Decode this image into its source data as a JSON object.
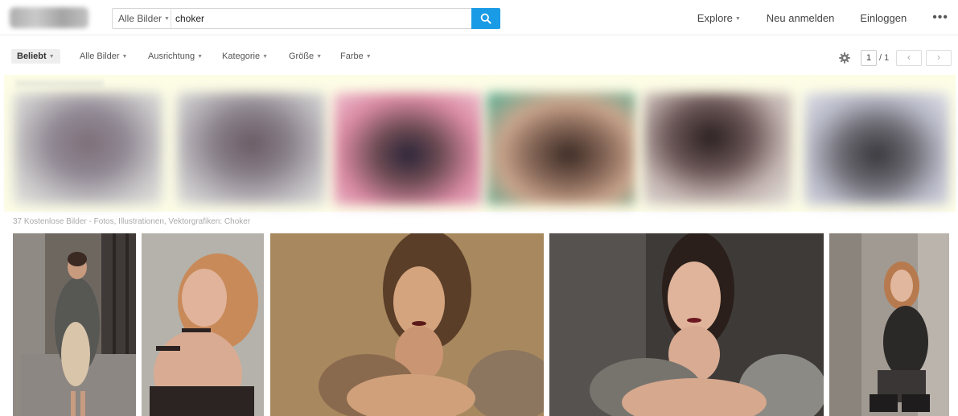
{
  "header": {
    "search_scope": "Alle Bilder",
    "search_value": "choker",
    "nav": {
      "explore": "Explore",
      "register": "Neu anmelden",
      "login": "Einloggen",
      "more": "•••"
    }
  },
  "filters": {
    "sort": "Beliebt",
    "type": "Alle Bilder",
    "orientation": "Ausrichtung",
    "category": "Kategorie",
    "size": "Größe",
    "color": "Farbe"
  },
  "pagination": {
    "current": "1",
    "total": "/ 1",
    "prev": "‹",
    "next": "›"
  },
  "results": {
    "summary": "37 Kostenlose Bilder - Fotos, Illustrationen, Vektorgrafiken: Choker"
  },
  "icons": {
    "search": "search-icon",
    "settings": "gear-icon",
    "dropdown": "caret-down-icon"
  },
  "colors": {
    "accent": "#1a9be6",
    "sponsored_bg": "#fdfde6"
  }
}
